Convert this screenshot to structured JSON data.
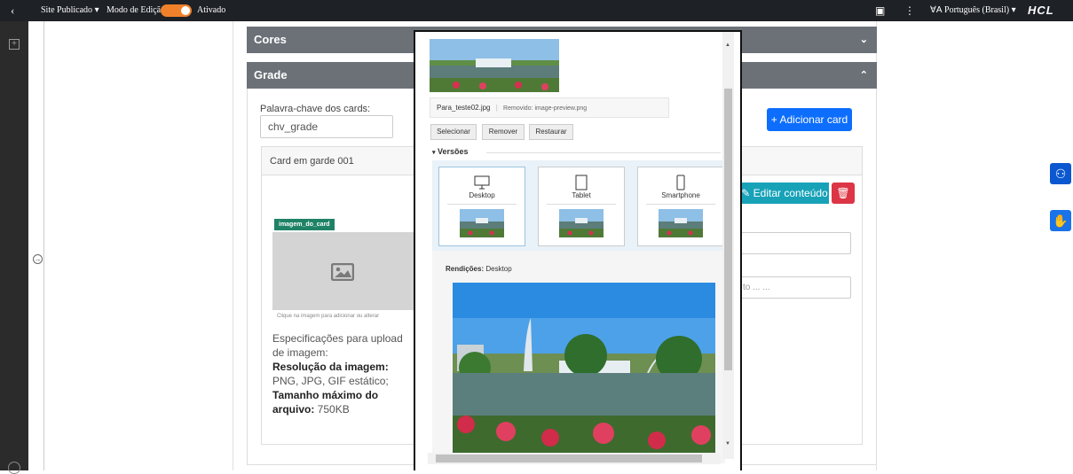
{
  "topbar": {
    "back_glyph": "‹",
    "site_status": "Site Publicado",
    "site_caret": "▾",
    "edit_mode_label": "Modo de Edição:",
    "edit_mode_state": "Ativado",
    "page_icon": "▣",
    "more_glyph": "⋮",
    "language_label": "Português (Brasil)",
    "language_caret": "▾",
    "brand": "HCL"
  },
  "accordion": {
    "cores_title": "Cores",
    "cores_chevron": "⌄",
    "grade_title": "Grade",
    "grade_chevron": "⌃"
  },
  "grade": {
    "keyword_label": "Palavra-chave dos cards:",
    "keyword_value": "chv_grade",
    "add_card_button": "+ Adicionar card",
    "card_title": "Card em garde 001",
    "edit_content_button": "Editar conteúdo",
    "image_tag": "imagem_do_card",
    "image_hint": "Clique na imagem para adicionar ou alterar",
    "link_placeholder": "to ... ...",
    "spec_intro": "Especificações para upload de imagem:",
    "spec_resolution_label": "Resolução da imagem:",
    "spec_resolution_value": " PNG, JPG, GIF estático;",
    "spec_size_label": "Tamanho máximo do arquivo:",
    "spec_size_value": " 750KB"
  },
  "modal": {
    "file_name": "Para_teste02.jpg",
    "file_separator": "|",
    "removed_text": "Removido: image-preview.png",
    "btn_select": "Selecionar",
    "btn_remove": "Remover",
    "btn_restore": "Restaurar",
    "versions_title": "Versões",
    "versions_caret": "▾",
    "versions": [
      {
        "label": "Desktop",
        "icon": "desktop-icon"
      },
      {
        "label": "Tablet",
        "icon": "tablet-icon"
      },
      {
        "label": "Smartphone",
        "icon": "smartphone-icon"
      }
    ],
    "renditions_label": "Rendições:",
    "renditions_value": " Desktop"
  },
  "colors": {
    "topbar_bg": "#1e2126",
    "accordion_bg": "#6c7178",
    "primary": "#0d6efd",
    "danger": "#dc3545",
    "teal_tag": "#1f8266",
    "toggle": "#f0812a",
    "edit_button": "#17a2b8"
  }
}
